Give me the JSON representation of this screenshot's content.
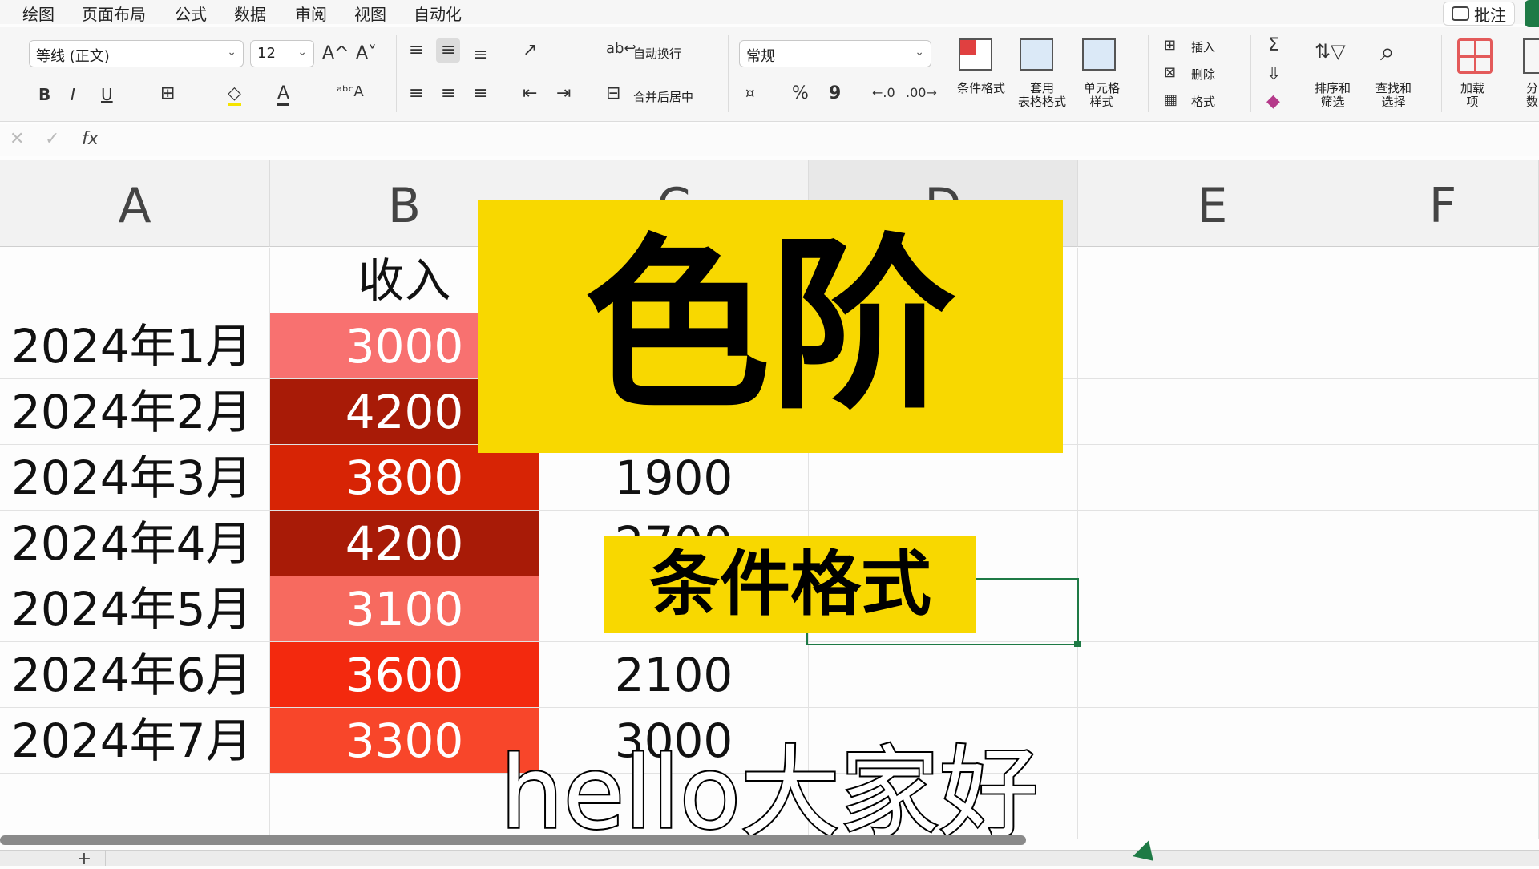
{
  "menu": [
    "绘图",
    "页面布局",
    "公式",
    "数据",
    "审阅",
    "视图",
    "自动化"
  ],
  "comment_label": "批注",
  "ribbon": {
    "font_name": "等线 (正文)",
    "font_size": "12",
    "grow_font": "A^",
    "shrink_font": "A˅",
    "bold": "B",
    "italic": "I",
    "underline": "U",
    "font_color_letter": "A",
    "wrap_text": "自动换行",
    "merge_center": "合并后居中",
    "number_format": "常规",
    "percent": "%",
    "comma": "9",
    "cond_format": "条件格式",
    "table_format": "套用\n表格格式",
    "cell_style": "单元格\n样式",
    "insert": "插入",
    "delete": "删除",
    "format": "格式",
    "sum": "Σ",
    "sort_filter": "排序和\n筛选",
    "find_select": "查找和\n选择",
    "addins": "加载\n项",
    "split_text": "分\n数"
  },
  "formula_bar": {
    "fx": "fx",
    "cancel": "✕",
    "confirm": "✓"
  },
  "columns": [
    "A",
    "B",
    "C",
    "D",
    "E",
    "F"
  ],
  "sheet": {
    "header_b": "收入",
    "rows": [
      {
        "a": "2024年1月",
        "b": "3000",
        "c": "",
        "b_color": "#f87170"
      },
      {
        "a": "2024年2月",
        "b": "4200",
        "c": "",
        "b_color": "#a81b07"
      },
      {
        "a": "2024年3月",
        "b": "3800",
        "c": "1900",
        "b_color": "#d72405"
      },
      {
        "a": "2024年4月",
        "b": "4200",
        "c": "2700",
        "b_color": "#a81b07"
      },
      {
        "a": "2024年5月",
        "b": "3100",
        "c": "",
        "b_color": "#f76a5f"
      },
      {
        "a": "2024年6月",
        "b": "3600",
        "c": "2100",
        "b_color": "#f3290e"
      },
      {
        "a": "2024年7月",
        "b": "3300",
        "c": "3000",
        "b_color": "#f8462a"
      }
    ]
  },
  "overlay": {
    "title": "色阶",
    "subtitle": "条件格式",
    "caption": "hello大家好"
  },
  "add_sheet": "+"
}
